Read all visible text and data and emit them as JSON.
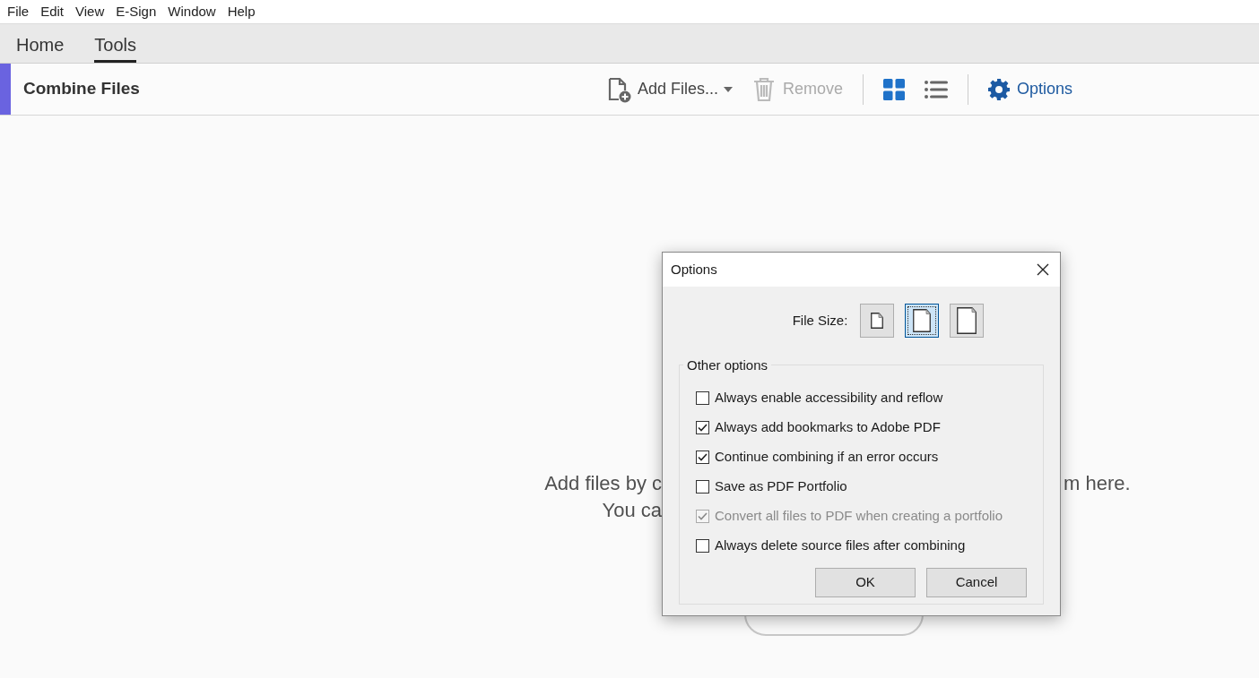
{
  "menu_bar": [
    "File",
    "Edit",
    "View",
    "E-Sign",
    "Window",
    "Help"
  ],
  "tabs": [
    {
      "label": "Home",
      "selected": false
    },
    {
      "label": "Tools",
      "selected": true
    }
  ],
  "toolbar": {
    "title": "Combine Files",
    "add_files": "Add Files...",
    "remove": {
      "label": "Remove",
      "disabled": true
    },
    "views": [
      {
        "kind": "grid",
        "selected": true
      },
      {
        "kind": "list",
        "selected": false
      }
    ],
    "options": "Options"
  },
  "background": {
    "line_1_left": "Add files by c",
    "line_1_right": "m here.",
    "line_2_left": "You ca"
  },
  "dialog": {
    "title": "Options",
    "file_size_label": "File Size:",
    "file_sizes": [
      {
        "kind": "small",
        "selected": false
      },
      {
        "kind": "medium",
        "selected": true
      },
      {
        "kind": "large",
        "selected": false
      }
    ],
    "group_title": "Other options",
    "options": [
      {
        "label": "Always enable accessibility and reflow",
        "checked": false,
        "disabled": false
      },
      {
        "label": "Always add bookmarks to Adobe PDF",
        "checked": true,
        "disabled": false
      },
      {
        "label": "Continue combining if an error occurs",
        "checked": true,
        "disabled": false
      },
      {
        "label": "Save as PDF Portfolio",
        "checked": false,
        "disabled": false
      },
      {
        "label": "Convert all files to PDF when creating a portfolio",
        "checked": true,
        "disabled": true
      },
      {
        "label": "Always delete source files after combining",
        "checked": false,
        "disabled": false
      }
    ],
    "buttons": [
      "OK",
      "Cancel"
    ]
  }
}
